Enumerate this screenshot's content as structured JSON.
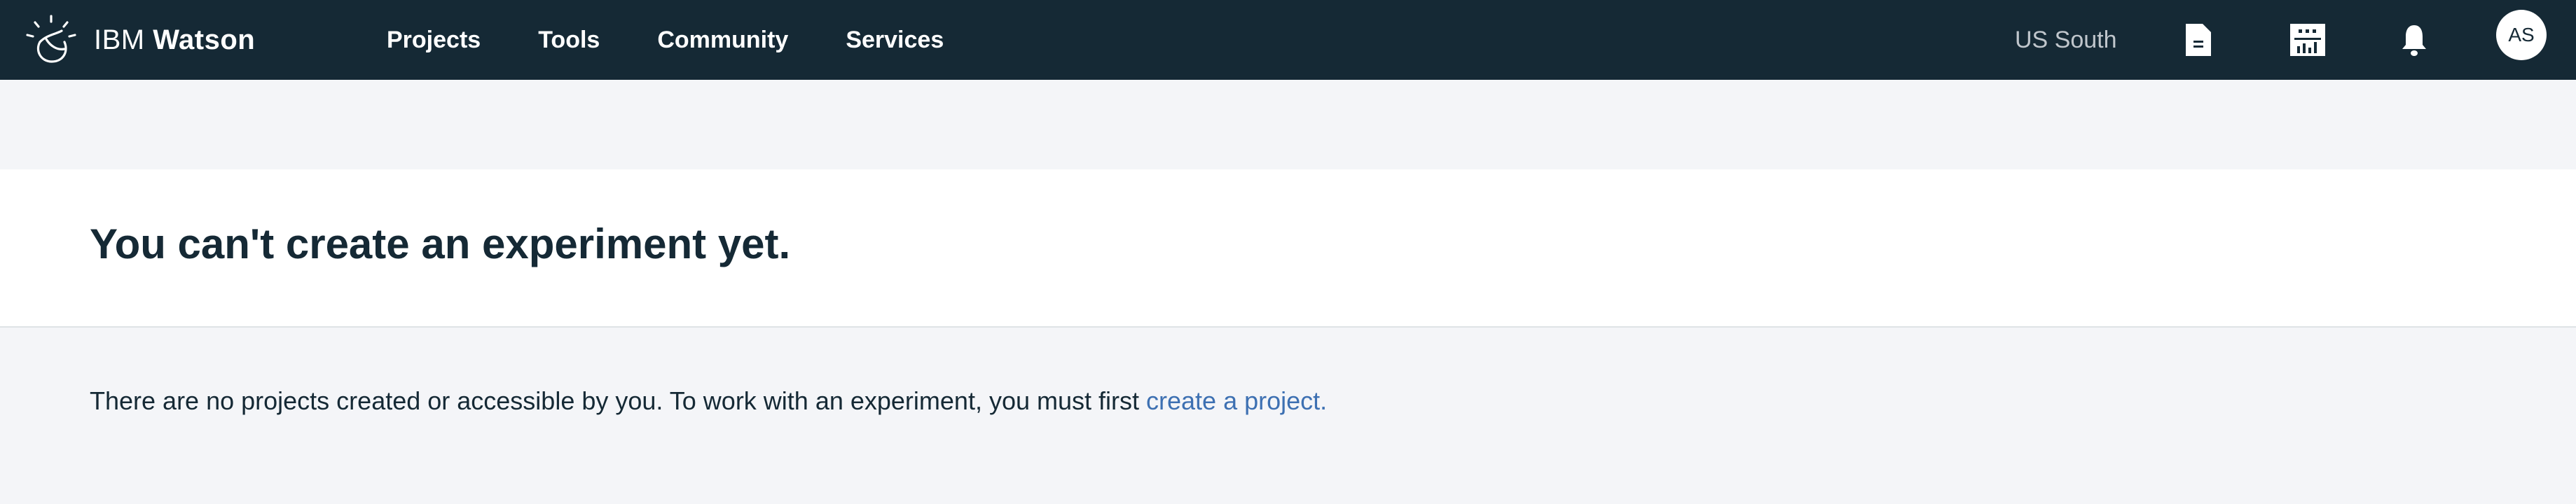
{
  "header": {
    "brand_light": "IBM",
    "brand_bold": "Watson",
    "nav": [
      {
        "label": "Projects"
      },
      {
        "label": "Tools"
      },
      {
        "label": "Community"
      },
      {
        "label": "Services"
      }
    ],
    "region": "US South",
    "icons": [
      "document-icon",
      "catalog-grid-icon",
      "notification-bell-icon"
    ],
    "avatar_initials": "AS"
  },
  "main": {
    "title": "You can't create an experiment yet.",
    "message_text": "There are no projects created or accessible by you. To work with an experiment, you must first ",
    "message_link": "create a project."
  },
  "colors": {
    "header_bg": "#152935",
    "page_bg": "#f4f5f8",
    "title_band_bg": "#ffffff",
    "link": "#3d70b2",
    "text": "#152935"
  }
}
